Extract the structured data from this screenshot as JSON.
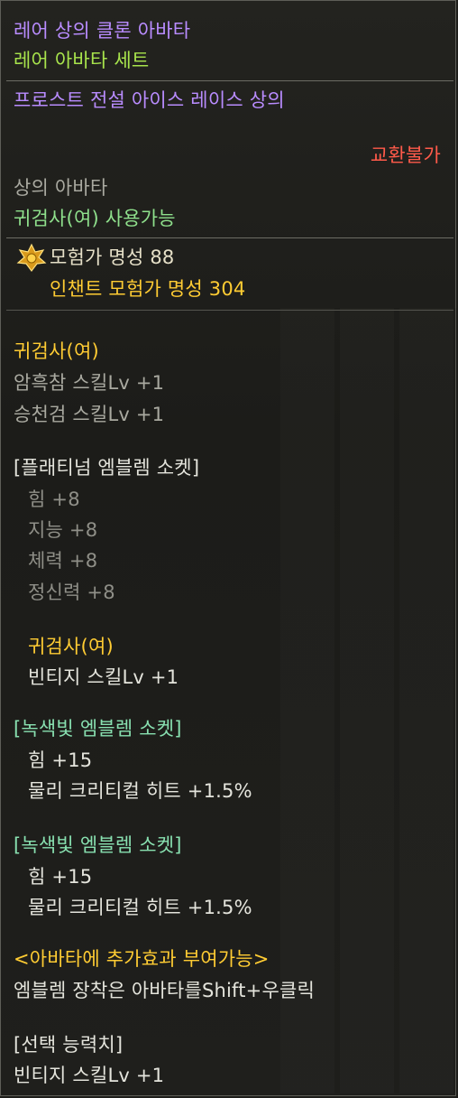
{
  "header": {
    "item_class": "레어 상의 클론 아바타",
    "set_name": "레어 아바타 세트",
    "item_name": "프로스트 전설 아이스 레이스 상의",
    "trade_status": "교환불가"
  },
  "info": {
    "slot": "상의 아바타",
    "usable_by": "귀검사(여) 사용가능"
  },
  "fame": {
    "adventurer": "모험가 명성 88",
    "enchant": "인챈트 모험가 명성 304"
  },
  "skills": {
    "class": "귀검사(여)",
    "lines": [
      "암흑참 스킬Lv +1",
      "승천검 스킬Lv +1"
    ]
  },
  "platinum_socket": {
    "title": "[플래티넘 엠블렘 소켓]",
    "stats": [
      "힘 +8",
      "지능 +8",
      "체력 +8",
      "정신력 +8"
    ],
    "class": "귀검사(여)",
    "skill": "빈티지 스킬Lv +1"
  },
  "green_socket_1": {
    "title": "[녹색빛 엠블렘 소켓]",
    "stats": [
      "힘 +15",
      "물리 크리티컬 히트 +1.5%"
    ]
  },
  "green_socket_2": {
    "title": "[녹색빛 엠블렘 소켓]",
    "stats": [
      "힘 +15",
      "물리 크리티컬 히트 +1.5%"
    ]
  },
  "avatar_effect": {
    "title": "<아바타에 추가효과 부여가능>",
    "desc": "엠블렘 장착은 아바타를Shift+우클릭"
  },
  "selected": {
    "title": "[선택 능력치]",
    "value": "빈티지 스킬Lv +1"
  },
  "icons": [
    "fame-badge-icon"
  ],
  "colors": {
    "rare_purple": "#b98cff",
    "set_lime": "#a8e44c",
    "untradeable_red": "#ff5a4a",
    "skill_yellow": "#ffcc33",
    "green_socket": "#88e0b0"
  }
}
